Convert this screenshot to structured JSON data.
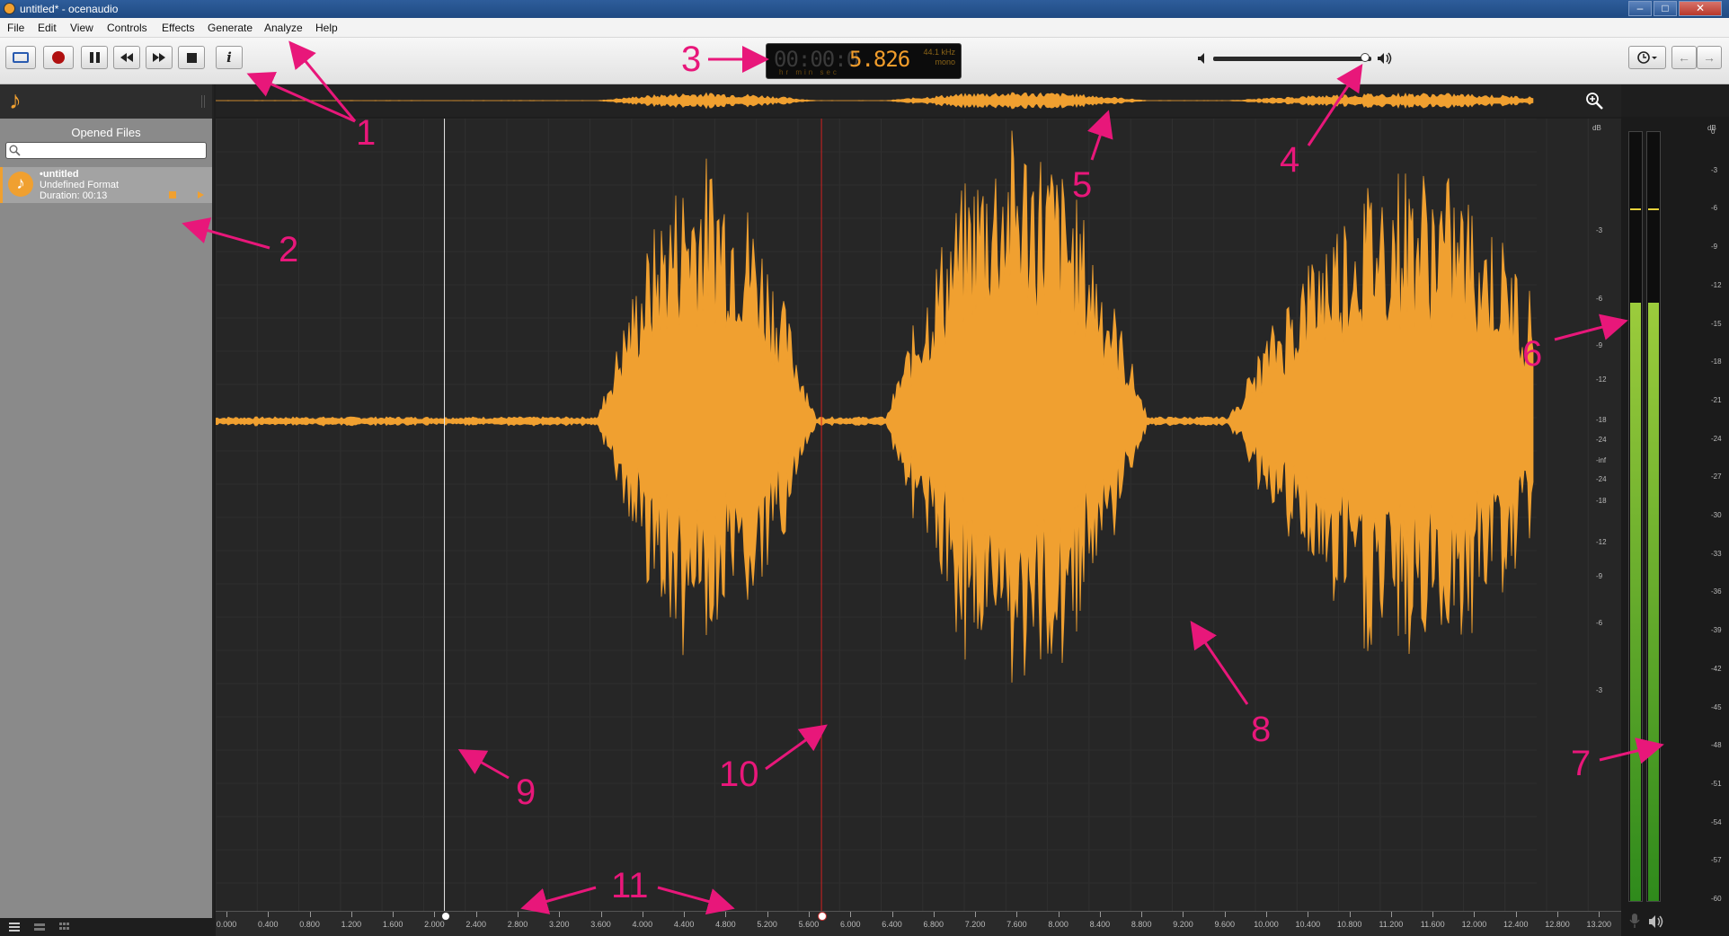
{
  "window": {
    "title": "untitled* - ocenaudio",
    "controls": [
      "–",
      "□",
      "✕"
    ]
  },
  "menu": [
    "File",
    "Edit",
    "View",
    "Controls",
    "Effects",
    "Generate",
    "Analyze",
    "Help"
  ],
  "toolbar": {
    "buttons": [
      "view-toggle",
      "record",
      "pause",
      "rewind",
      "fast-forward",
      "stop",
      "info"
    ],
    "info_label": "i",
    "time": {
      "dim": "00:00:0",
      "value": "5.826",
      "units": "hr   min   sec",
      "sample_rate": "44.1 kHz",
      "channels": "mono"
    },
    "volume_fraction": 0.96
  },
  "sidebar": {
    "title": "Opened Files",
    "search_placeholder": "",
    "files": [
      {
        "name": "•untitled",
        "format": "Undefined Format",
        "duration": "Duration: 00:13"
      }
    ]
  },
  "waveform": {
    "color": "#f0a030",
    "selection_start_seconds": 2.2,
    "cursor_seconds": 5.826,
    "total_seconds": 13.5,
    "db_scale_label": "dB",
    "db_ticks_top": [
      "-3",
      "-6",
      "-9",
      "-12",
      "-18",
      "-24",
      "-inf"
    ],
    "db_ticks_bottom": [
      "-24",
      "-18",
      "-12",
      "-9",
      "-6",
      "-3"
    ]
  },
  "ruler": {
    "labels": [
      "0.000",
      "0.400",
      "0.800",
      "1.200",
      "1.600",
      "2.000",
      "2.400",
      "2.800",
      "3.200",
      "3.600",
      "4.000",
      "4.400",
      "4.800",
      "5.200",
      "5.600",
      "6.000",
      "6.400",
      "6.800",
      "7.200",
      "7.600",
      "8.000",
      "8.400",
      "8.800",
      "9.200",
      "9.600",
      "10.000",
      "10.400",
      "10.800",
      "11.200",
      "11.600",
      "12.000",
      "12.400",
      "12.800",
      "13.200"
    ]
  },
  "meters": {
    "label": "dB",
    "scale": [
      "0",
      "-3",
      "-6",
      "-9",
      "-12",
      "-15",
      "-18",
      "-21",
      "-24",
      "-27",
      "-30",
      "-33",
      "-36",
      "-39",
      "-42",
      "-45",
      "-48",
      "-51",
      "-54",
      "-57",
      "-60"
    ],
    "level_fraction": 0.78,
    "peak_fraction": 0.9
  },
  "annotations": [
    "1",
    "2",
    "3",
    "4",
    "5",
    "6",
    "7",
    "8",
    "9",
    "10",
    "11"
  ],
  "accent_color": "#e8177a"
}
